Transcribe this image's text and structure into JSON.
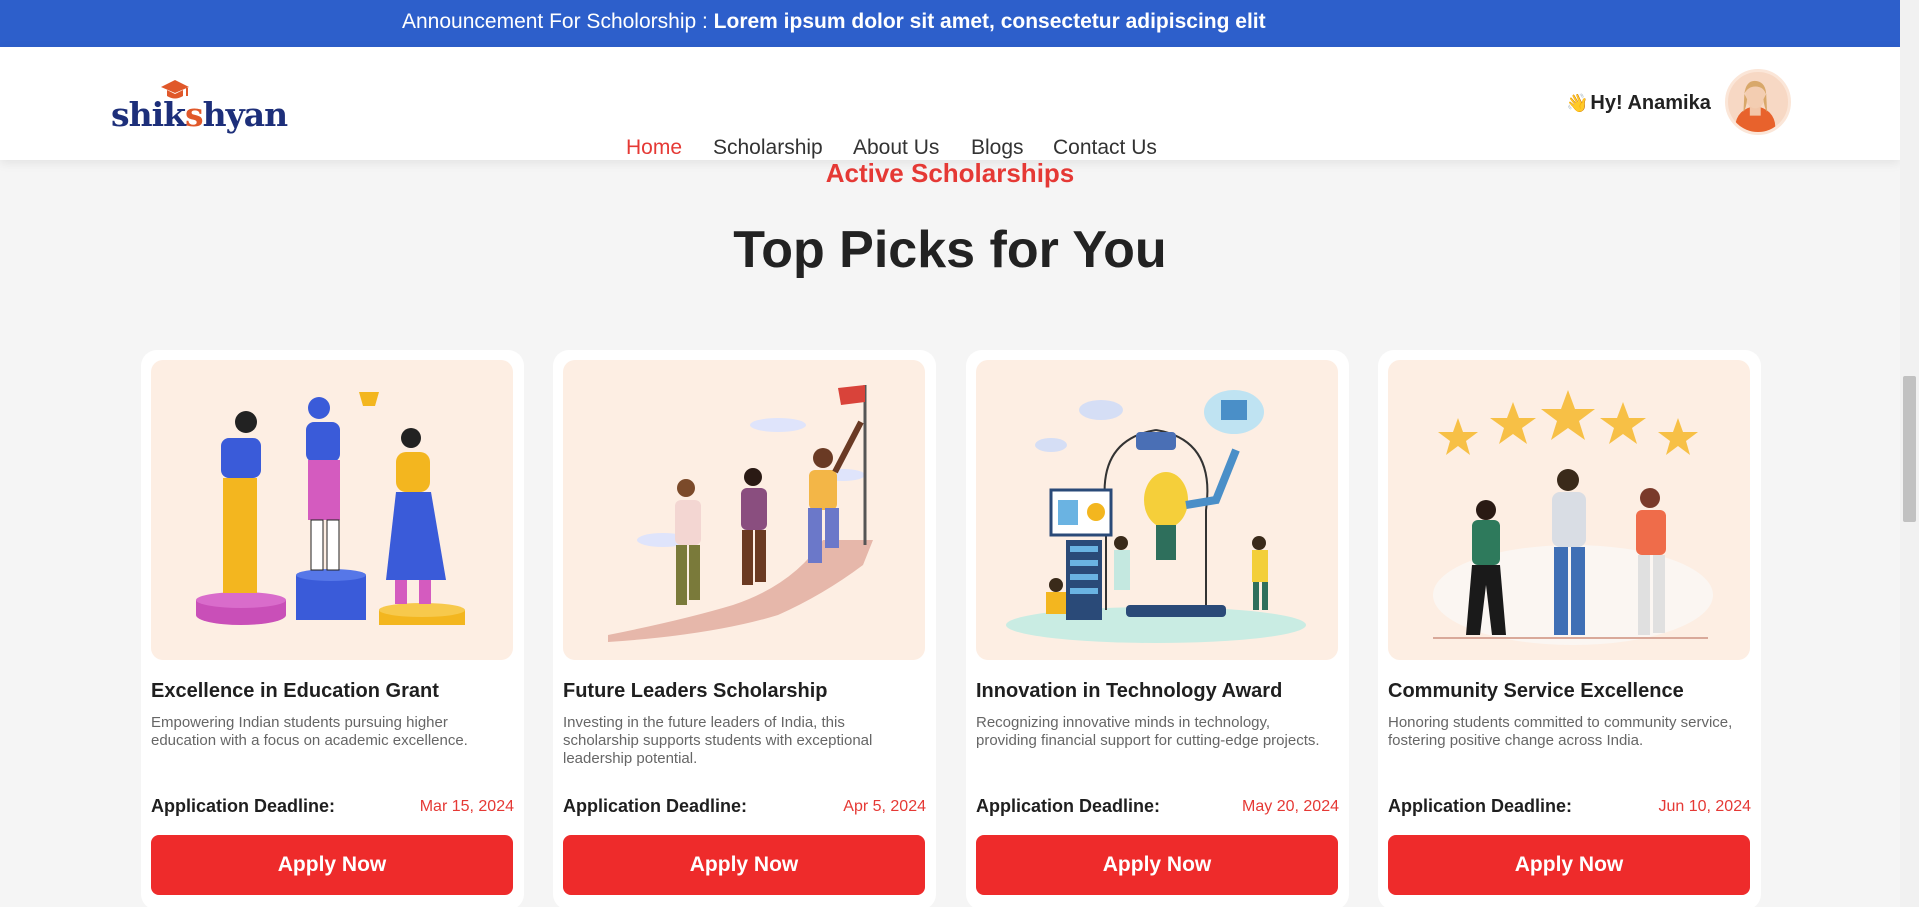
{
  "announcement": {
    "label": "Announcement For Scholorship : ",
    "message": "Lorem ipsum dolor sit amet, consectetur adipiscing elit"
  },
  "header": {
    "logo_text_a": "shik",
    "logo_text_b": "s",
    "logo_text_c": "hyan",
    "nav": [
      {
        "label": "Home",
        "active": true
      },
      {
        "label": "Scholarship"
      },
      {
        "label": "About Us"
      },
      {
        "label": "Blogs"
      },
      {
        "label": "Contact Us"
      }
    ],
    "greeting_icon": "👋",
    "greeting": "Hy! Anamika"
  },
  "section": {
    "eyebrow": "Active Scholarships",
    "title": "Top Picks for You"
  },
  "deadline_label": "Application Deadline:",
  "apply_label": "Apply Now",
  "cards": [
    {
      "title": "Excellence in Education Grant",
      "description": "Empowering Indian students pursuing higher education with a focus on academic excellence.",
      "deadline": "Mar 15, 2024",
      "illustration": "podium-trophy-illustration"
    },
    {
      "title": "Future Leaders Scholarship",
      "description": "Investing in the future leaders of India, this scholarship supports students with exceptional leadership potential.",
      "deadline": "Apr 5, 2024",
      "illustration": "climbing-flag-illustration"
    },
    {
      "title": "Innovation in Technology Award",
      "description": "Recognizing innovative minds in technology, providing financial support for cutting-edge projects.",
      "deadline": "May 20, 2024",
      "illustration": "tech-lightbulb-illustration"
    },
    {
      "title": "Community Service Excellence",
      "description": "Honoring students committed to community service, fostering positive change across India.",
      "deadline": "Jun 10, 2024",
      "illustration": "five-stars-celebration-illustration"
    }
  ],
  "colors": {
    "announcement_bg": "#2d5fcb",
    "accent_red": "#e53935",
    "button_red": "#ee2b2b",
    "card_image_bg": "#fdeee3"
  }
}
